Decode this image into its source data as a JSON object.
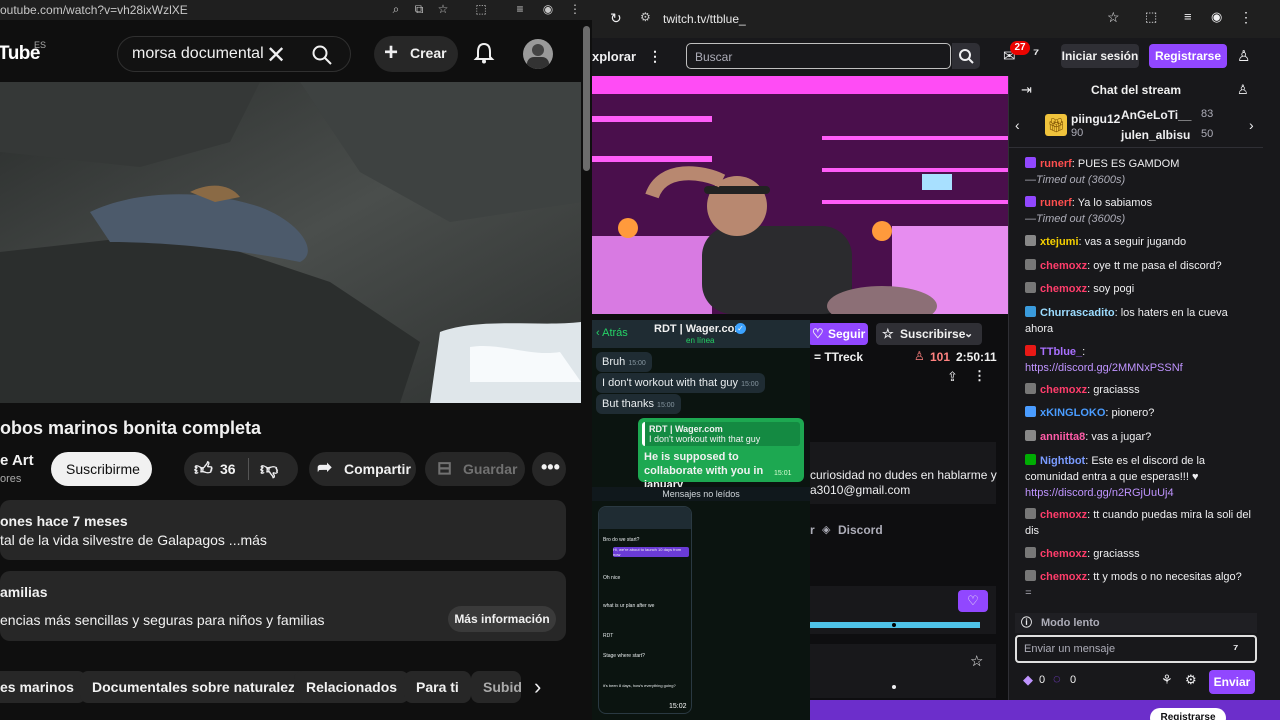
{
  "youtube": {
    "url": "outube.com/watch?v=vh28ixWzlXE",
    "logo": "Tube",
    "logo_region": "ES",
    "search_value": "morsa documental",
    "create_label": "Crear",
    "video_title": "obos marinos bonita completa",
    "channel_name": "e Art",
    "channel_subs": "ores",
    "subscribe_label": "Suscribirme",
    "likes": "36",
    "share_label": "Compartir",
    "save_label": "Guardar",
    "desc_meta": "ones  hace 7 meses",
    "desc_text": "tal de la vida silvestre de Galapagos ...más",
    "family_title": "amilias",
    "family_text": "encias más sencillas y seguras para niños y familias",
    "family_button": "Más información",
    "chips": [
      "es marinos",
      "Documentales sobre naturaleza",
      "Relacionados",
      "Para ti",
      "Subid"
    ]
  },
  "twitch": {
    "url": "twitch.tv/ttblue_",
    "explore": "xplorar",
    "search_placeholder": "Buscar",
    "notif_count": "27",
    "login_label": "Iniciar sesión",
    "register_label": "Registrarse",
    "follow_label": "Seguir",
    "subscribe_label": "Suscribirse",
    "streamer": "= TTreck",
    "viewers": "101",
    "uptime": "2:50:11",
    "panel_text": "curiosidad no dudes en hablarme y\na3010@gmail.com",
    "discord_label": "Discord",
    "discord_r": "r",
    "footer_button": "Registrarse"
  },
  "whatsapp": {
    "back_label": "Atrás",
    "contact": "RDT | Wager.com",
    "status": "en línea",
    "msg1": "Bruh",
    "msg1_time": "15:00",
    "msg2": "I don't workout with that guy",
    "msg2_time": "15:00",
    "msg3": "But thanks",
    "msg3_time": "15:00",
    "reply_quote_name": "RDT | Wager.com",
    "reply_quote_text": "I don't workout with that guy",
    "reply_text": "He is supposed to collaborate with you in january",
    "reply_time": "15:01",
    "unread_label": "Mensajes no leídos",
    "thumb_time": "15:02",
    "thumb_lines": [
      "Bro do we start?",
      "Hi, we're about to launch 10 days from now",
      "Oh nice",
      "what is ur plan after we",
      "RDT",
      "Stage where start?",
      "it's been 8 days, how's everything going?"
    ]
  },
  "chat": {
    "title": "Chat del stream",
    "hype": [
      {
        "name": "piingu12",
        "num": "90"
      },
      {
        "name": "AnGeLoTi__",
        "num": "83"
      },
      {
        "name": "julen_albisu",
        "num": "50"
      }
    ],
    "messages": [
      {
        "user": "runerf",
        "color": "#ff4f4f",
        "text": ": PUES ES GAMDOM",
        "sub": "—Timed out (3600s)"
      },
      {
        "user": "runerf",
        "color": "#ff4f4f",
        "text": ": Ya lo sabiamos",
        "sub": "—Timed out (3600s)"
      },
      {
        "user": "xtejumi",
        "color": "#f5d000",
        "text": ": vas a seguir jugando",
        "sub": ""
      },
      {
        "user": "chemoxz",
        "color": "#ff3d6b",
        "text": ": oye tt me pasa el discord?",
        "sub": ""
      },
      {
        "user": "chemoxz",
        "color": "#ff3d6b",
        "text": ": soy pogi",
        "sub": ""
      },
      {
        "user": "Churrascadito",
        "color": "#9cdcff",
        "text": ": los haters en la cueva ahora",
        "sub": ""
      },
      {
        "user": "TTblue_",
        "color": "#a970ff",
        "text": ": ",
        "link": "https://discord.gg/2MMNxPSSNf",
        "sub": ""
      },
      {
        "user": "chemoxz",
        "color": "#ff3d6b",
        "text": ": graciasss",
        "sub": ""
      },
      {
        "user": "xKINGLOKO",
        "color": "#4a9cff",
        "text": ": pionero?",
        "sub": ""
      },
      {
        "user": "anniitta8",
        "color": "#ff5ca8",
        "text": ": vas a jugar?",
        "sub": ""
      },
      {
        "user": "Nightbot",
        "color": "#7a9bff",
        "text": ": Este es el discord de la comunidad entra a que esperas!!! ♥",
        "link": "https://discord.gg/n2RGjUuUj4",
        "sub": ""
      },
      {
        "user": "chemoxz",
        "color": "#ff3d6b",
        "text": ": tt cuando puedas mira la soli del dis",
        "sub": ""
      },
      {
        "user": "chemoxz",
        "color": "#ff3d6b",
        "text": ": graciasss",
        "sub": ""
      },
      {
        "user": "chemoxz",
        "color": "#ff3d6b",
        "text": ": tt y mods o no necesitas algo?",
        "sub": "="
      }
    ],
    "slow_mode": "Modo lento",
    "input_placeholder": "Enviar un mensaje",
    "points_a": "0",
    "points_b": "0",
    "send_label": "Enviar"
  }
}
